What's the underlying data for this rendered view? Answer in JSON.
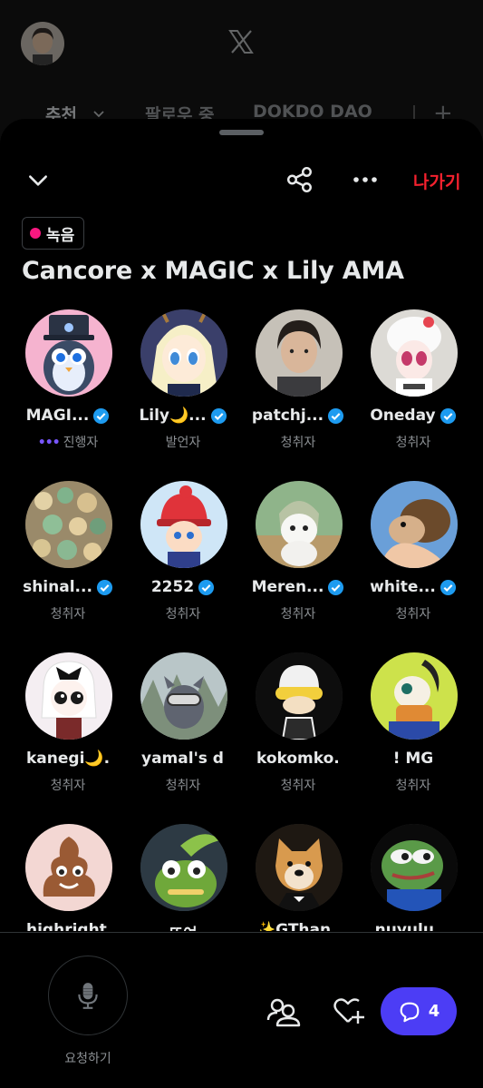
{
  "background": {
    "tabs": [
      {
        "label": "추천"
      },
      {
        "label": "팔로우 중"
      },
      {
        "label": "DOKDO DAO"
      }
    ]
  },
  "header": {
    "leave_label": "나가기",
    "recording_label": "녹음",
    "title": "Cancore x MAGIC x Lily AMA"
  },
  "participants": [
    {
      "name": "MAGI...",
      "role": "진행자",
      "host": true,
      "verified": true
    },
    {
      "name": "Lily🌙...",
      "role": "발언자",
      "verified": true
    },
    {
      "name": "patchj...",
      "role": "청취자",
      "verified": true
    },
    {
      "name": "Oneday",
      "role": "청취자",
      "verified": true
    },
    {
      "name": "shinal...",
      "role": "청취자",
      "verified": true
    },
    {
      "name": "2252",
      "role": "청취자",
      "verified": true
    },
    {
      "name": "Meren...",
      "role": "청취자",
      "verified": true
    },
    {
      "name": "white...",
      "role": "청취자",
      "verified": true
    },
    {
      "name": "kanegi🌙...",
      "role": "청취자",
      "verified": false
    },
    {
      "name": "yamal's d...",
      "role": "청취자",
      "verified": false
    },
    {
      "name": "kokomko...",
      "role": "청취자",
      "verified": false
    },
    {
      "name": "! MG",
      "role": "청취자",
      "verified": false
    },
    {
      "name": "highright...",
      "role": "",
      "verified": false
    },
    {
      "name": "또여",
      "role": "",
      "verified": false
    },
    {
      "name": "✨GThan...",
      "role": "",
      "verified": false
    },
    {
      "name": "nuyulu...",
      "role": "",
      "verified": false
    }
  ],
  "footer": {
    "request_label": "요청하기",
    "comment_count": "4"
  },
  "colors": {
    "accent": "#4c3df5",
    "leave": "#f4212e",
    "recording": "#f91880",
    "verified": "#1d9bf0",
    "host_dots": "#7856ff"
  }
}
